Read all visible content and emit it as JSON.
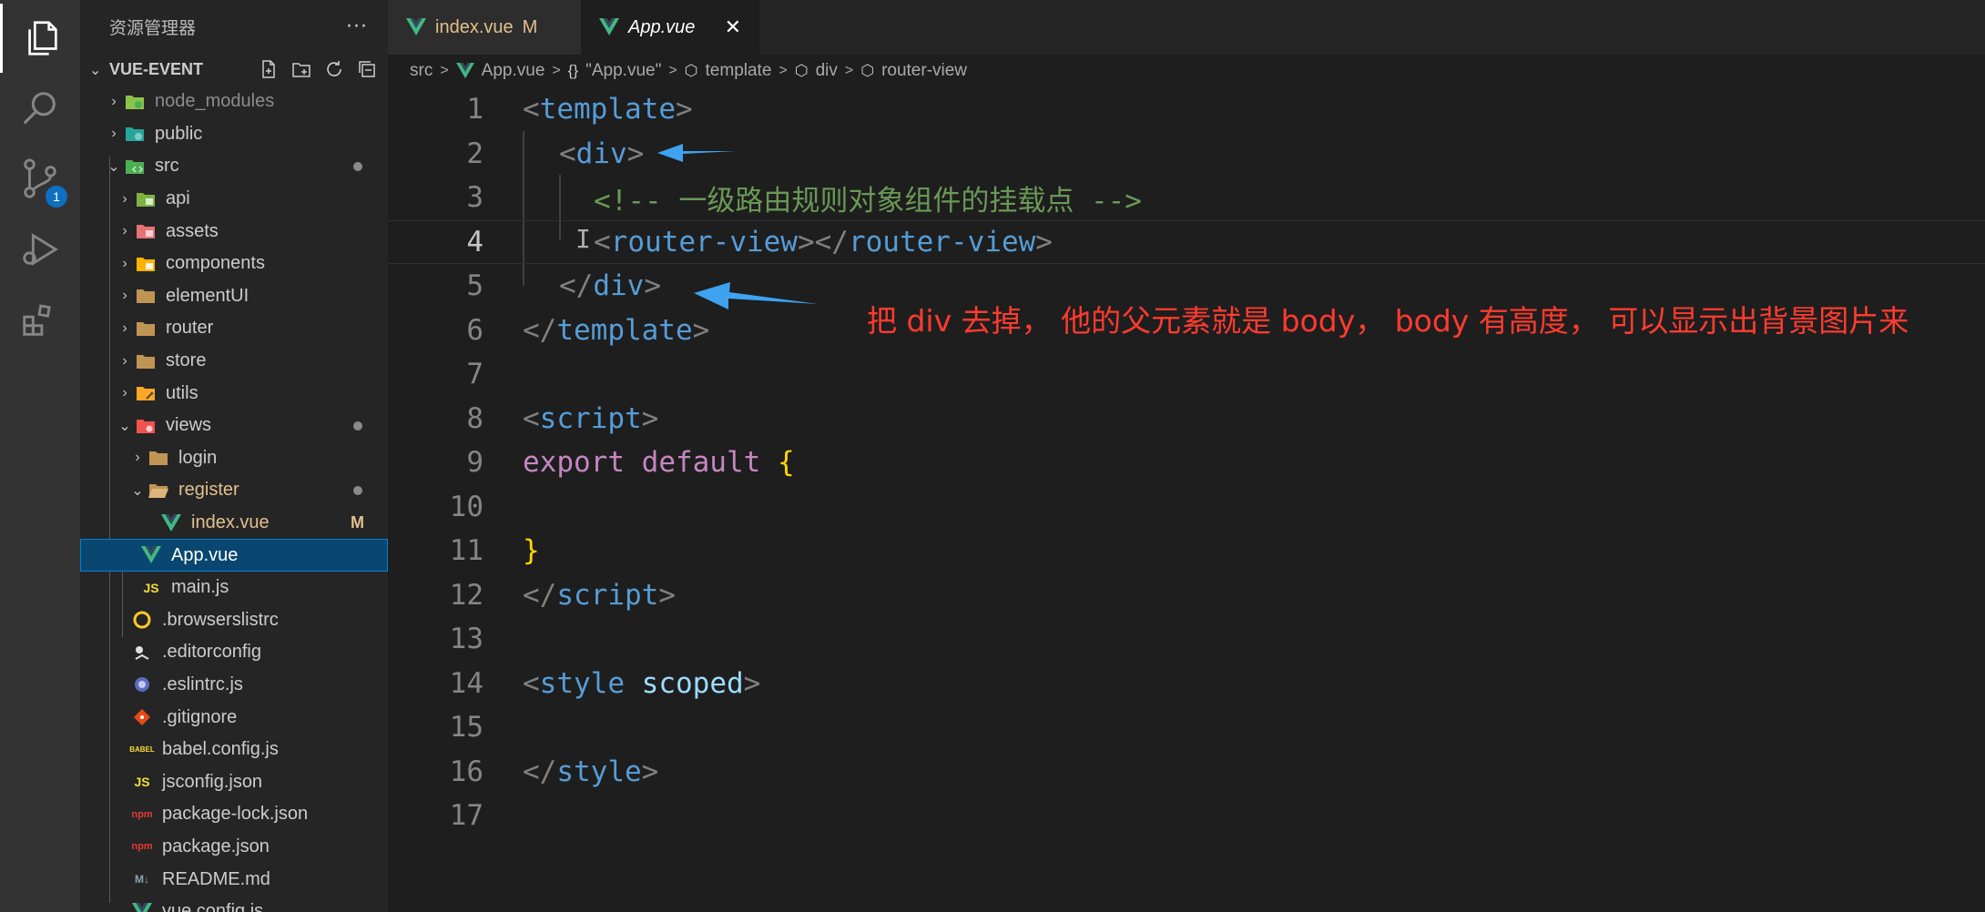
{
  "sidebar": {
    "title": "资源管理器",
    "more": "···",
    "project": "VUE-EVENT",
    "items": [
      {
        "label": "node_modules",
        "kind": "folder",
        "icon": "node-folder-icon"
      },
      {
        "label": "public",
        "kind": "folder",
        "icon": "public-folder-icon"
      },
      {
        "label": "src",
        "kind": "folder-open",
        "icon": "src-folder-icon"
      },
      {
        "label": "api",
        "kind": "folder",
        "icon": "api-folder-icon"
      },
      {
        "label": "assets",
        "kind": "folder",
        "icon": "assets-folder-icon"
      },
      {
        "label": "components",
        "kind": "folder",
        "icon": "components-folder-icon"
      },
      {
        "label": "elementUI",
        "kind": "folder",
        "icon": "folder-icon"
      },
      {
        "label": "router",
        "kind": "folder",
        "icon": "folder-icon"
      },
      {
        "label": "store",
        "kind": "folder",
        "icon": "folder-icon"
      },
      {
        "label": "utils",
        "kind": "folder",
        "icon": "utils-folder-icon"
      },
      {
        "label": "views",
        "kind": "folder-open",
        "icon": "views-folder-icon"
      },
      {
        "label": "login",
        "kind": "folder",
        "icon": "folder-icon"
      },
      {
        "label": "register",
        "kind": "folder-open",
        "icon": "folder-open-icon"
      },
      {
        "label": "index.vue",
        "kind": "file",
        "icon": "vue-file-icon",
        "badge": "M"
      },
      {
        "label": "App.vue",
        "kind": "file",
        "icon": "vue-file-icon"
      },
      {
        "label": "main.js",
        "kind": "file",
        "icon": "js-file-icon"
      },
      {
        "label": ".browserslistrc",
        "kind": "file",
        "icon": "browserslist-icon"
      },
      {
        "label": ".editorconfig",
        "kind": "file",
        "icon": "editorconfig-icon"
      },
      {
        "label": ".eslintrc.js",
        "kind": "file",
        "icon": "eslint-icon"
      },
      {
        "label": ".gitignore",
        "kind": "file",
        "icon": "git-icon"
      },
      {
        "label": "babel.config.js",
        "kind": "file",
        "icon": "babel-icon"
      },
      {
        "label": "jsconfig.json",
        "kind": "file",
        "icon": "js-file-icon"
      },
      {
        "label": "package-lock.json",
        "kind": "file",
        "icon": "npm-icon"
      },
      {
        "label": "package.json",
        "kind": "file",
        "icon": "npm-icon"
      },
      {
        "label": "README.md",
        "kind": "file",
        "icon": "markdown-icon"
      },
      {
        "label": "vue.config.js",
        "kind": "file",
        "icon": "vue-file-icon"
      }
    ],
    "icon_text": {
      "js": "JS",
      "md": "M↓",
      "babel": "BABEL",
      "npm": "npm"
    }
  },
  "activity": {
    "scm_badge": "1"
  },
  "tabs": [
    {
      "label": "index.vue",
      "badge": "M"
    },
    {
      "label": "App.vue",
      "close": "✕"
    }
  ],
  "breadcrumb": {
    "parts": [
      "src",
      "App.vue",
      "\"App.vue\"",
      "template",
      "div",
      "router-view"
    ],
    "brace_icon": "{}",
    "sep": ">"
  },
  "editor": {
    "line_numbers": [
      "1",
      "2",
      "3",
      "4",
      "5",
      "6",
      "7",
      "8",
      "9",
      "10",
      "11",
      "12",
      "13",
      "14",
      "15",
      "16",
      "17"
    ],
    "lines": {
      "l1": [
        "<",
        "template",
        ">"
      ],
      "l2": [
        "<",
        "div",
        ">"
      ],
      "l3": "<!-- 一级路由规则对象组件的挂载点 -->",
      "l4": [
        "<",
        "router-view",
        "></",
        "router-view",
        ">"
      ],
      "l5": [
        "</",
        "div",
        ">"
      ],
      "l6": [
        "</",
        "template",
        ">"
      ],
      "l8": [
        "<",
        "script",
        ">"
      ],
      "l9": [
        "export",
        " ",
        "default",
        " ",
        "{"
      ],
      "l11": "}",
      "l12": [
        "</",
        "script",
        ">"
      ],
      "l14": [
        "<",
        "style",
        " ",
        "scoped",
        ">"
      ],
      "l16": [
        "</",
        "style",
        ">"
      ]
    },
    "cursor": "I"
  },
  "annotation": "把 div 去掉， 他的父元素就是 body， body 有高度， 可以显示出背景图片来",
  "colors": {
    "arrow": "#3ea2f0",
    "annotation": "#ff3b2f",
    "selection": "#094771"
  }
}
